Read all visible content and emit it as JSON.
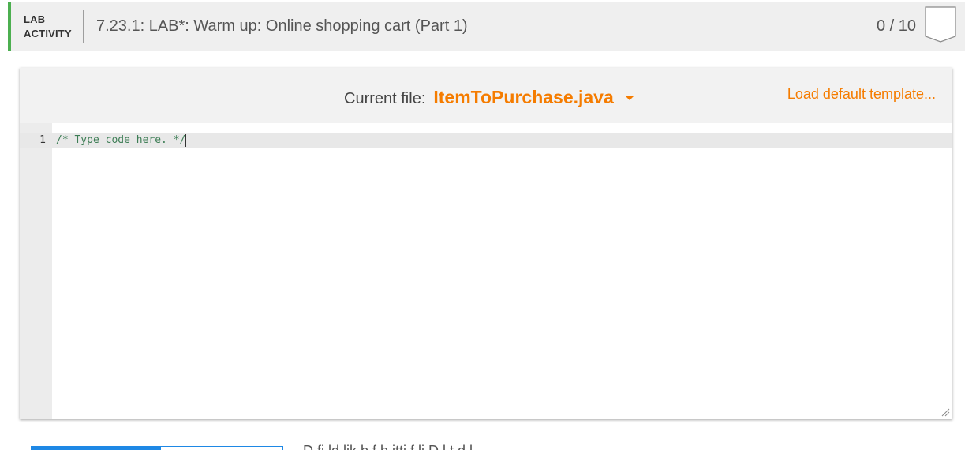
{
  "activity": {
    "type_line1": "LAB",
    "type_line2": "ACTIVITY",
    "title": "7.23.1: LAB*: Warm up: Online shopping cart (Part 1)",
    "score": "0 / 10",
    "accent_color": "#4caf50"
  },
  "editor": {
    "current_file_label": "Current file:",
    "file_name": "ItemToPurchase.java",
    "load_template_label": "Load default template...",
    "accent_color": "#f57c00",
    "lines": [
      {
        "number": "1",
        "code": "/* Type code here. */"
      }
    ]
  },
  "footer": {
    "partial_text": "D                                          fi           ld lik   b f        b itti   f           li    D l         t          d  l"
  }
}
